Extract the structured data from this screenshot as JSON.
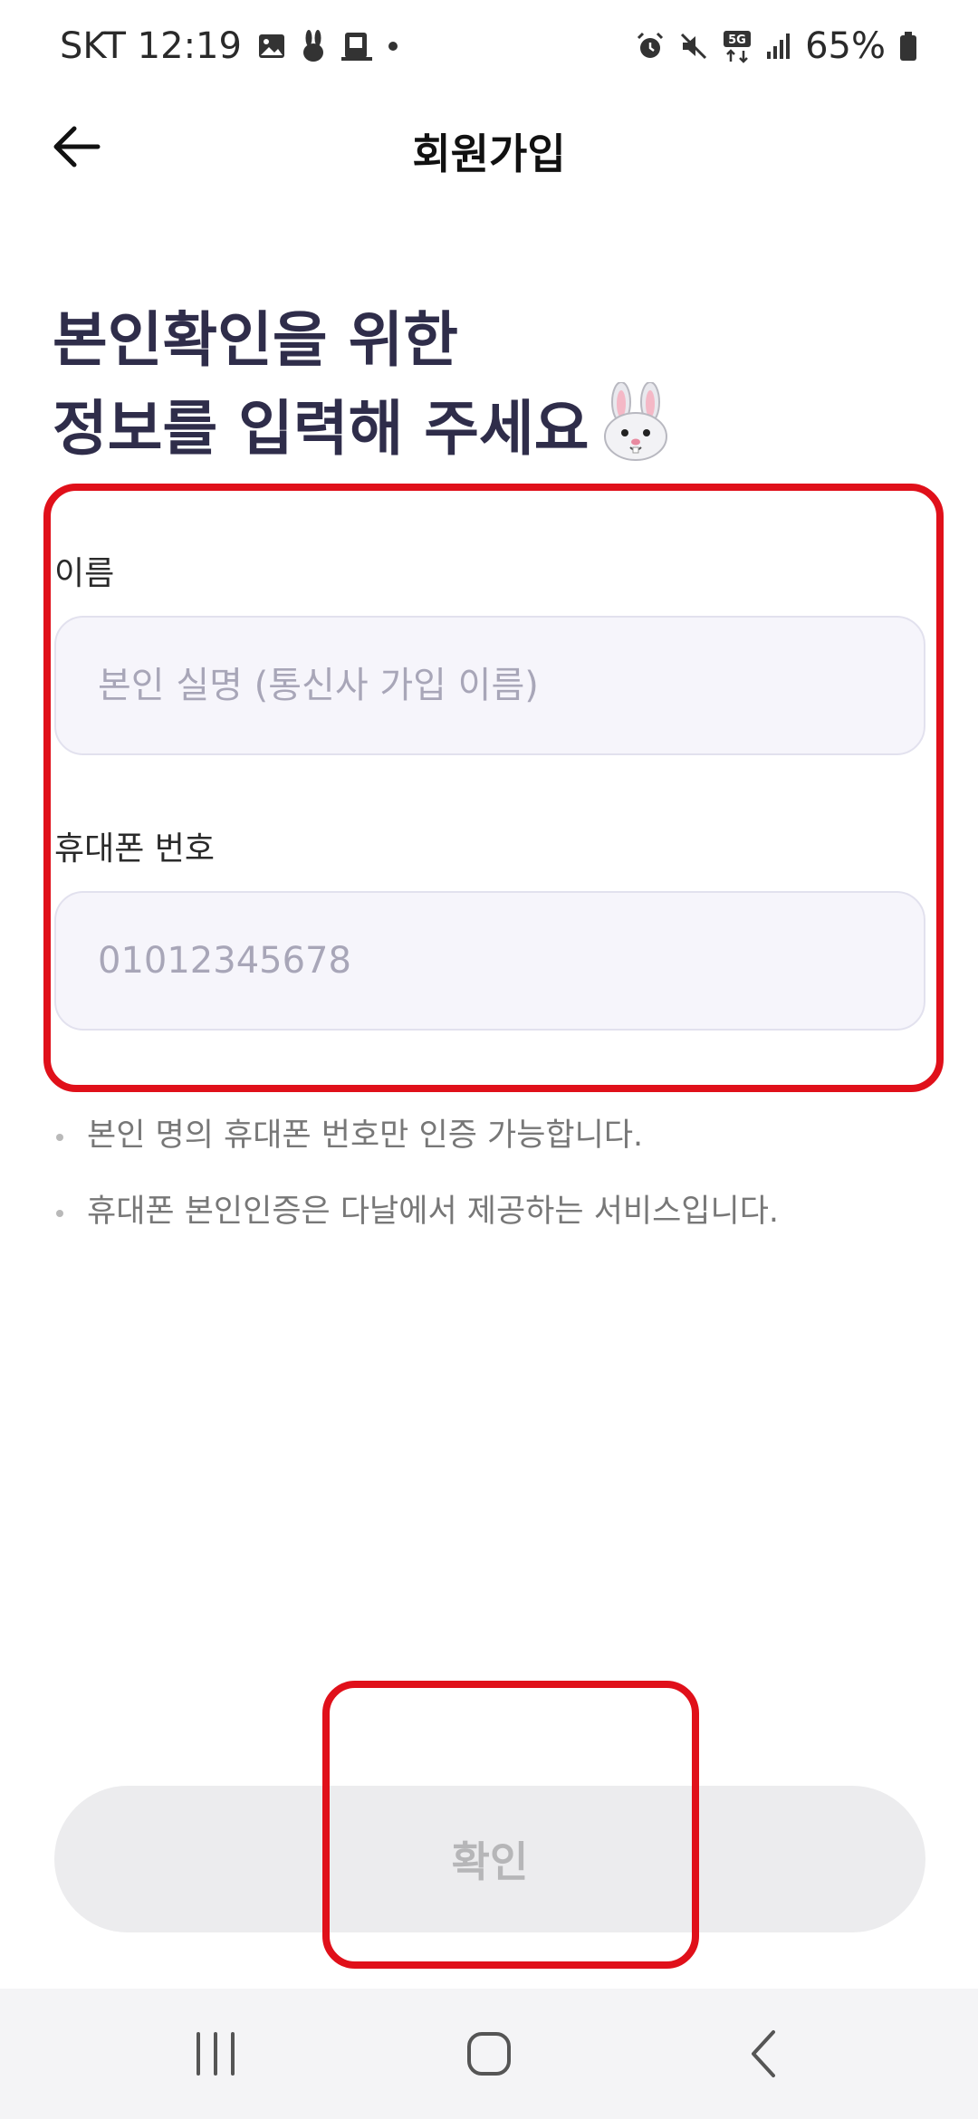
{
  "status_bar": {
    "carrier_time": "SKT 12:19",
    "battery": "65%",
    "network": "5G"
  },
  "app_bar": {
    "title": "회원가입"
  },
  "heading": {
    "line1": "본인확인을 위한",
    "line2": "정보를 입력해 주세요",
    "emoji": "🐰"
  },
  "form": {
    "name_label": "이름",
    "name_placeholder": "본인 실명 (통신사 가입 이름)",
    "name_value": "",
    "phone_label": "휴대폰 번호",
    "phone_placeholder": "01012345678",
    "phone_value": ""
  },
  "notes": [
    "본인 명의 휴대폰 번호만 인증 가능합니다.",
    "휴대폰 본인인증은 다날에서 제공하는 서비스입니다."
  ],
  "confirm_button": {
    "label": "확인"
  },
  "colors": {
    "heading": "#2f2d4a",
    "input_bg": "#f6f5fb",
    "highlight": "#e0101a",
    "button_disabled_bg": "#ececee",
    "button_disabled_text": "#b6b6b8"
  },
  "icons": {
    "back": "arrow-left-icon",
    "gallery": "image-icon",
    "rabbit": "rabbit-icon",
    "app": "phone-app-icon",
    "alarm": "alarm-icon",
    "mute": "mute-icon",
    "signal": "signal-icon",
    "battery": "battery-icon",
    "nav_recents": "recents-icon",
    "nav_home": "home-icon",
    "nav_back": "chevron-left-icon"
  }
}
